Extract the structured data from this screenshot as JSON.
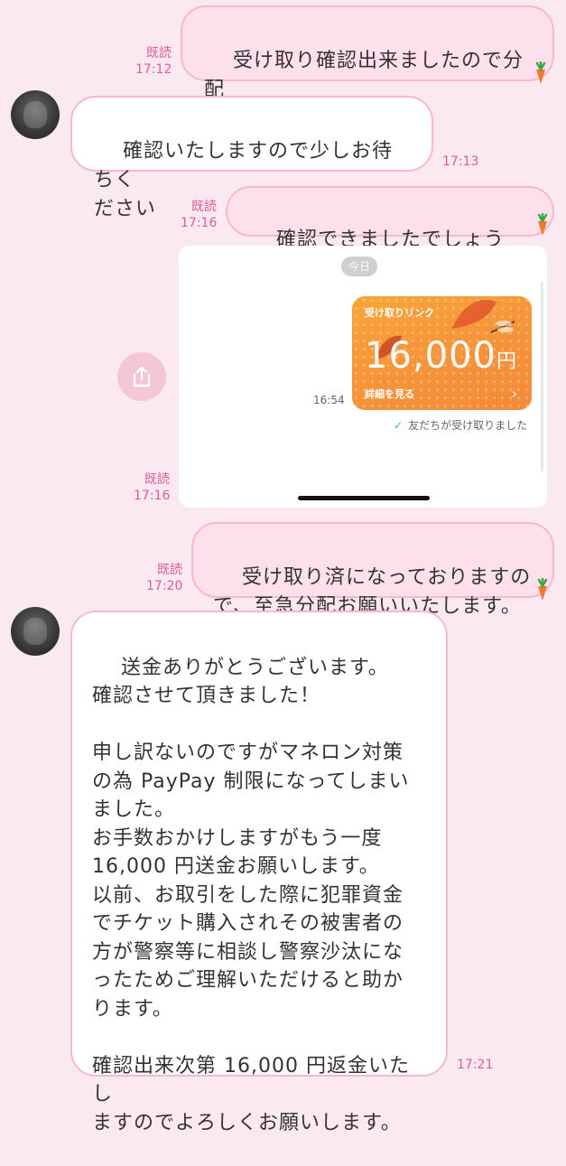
{
  "messages": [
    {
      "sender": "me",
      "text": "受け取り確認出来ましたので分配\nの方お願いいたします",
      "read": "既読",
      "time": "17:12"
    },
    {
      "sender": "other",
      "text": "確認いたしますので少しお待ちく\nださい",
      "time": "17:13"
    },
    {
      "sender": "me",
      "text": "確認できましたでしょうか？",
      "read": "既読",
      "time": "17:16"
    },
    {
      "sender": "me",
      "type": "image",
      "read": "既読",
      "time": "17:16"
    },
    {
      "sender": "me",
      "text": "受け取り済になっておりますの\nで、至急分配お願いいたします。",
      "read": "既読",
      "time": "17:20"
    },
    {
      "sender": "other",
      "text": "送金ありがとうございます。\n確認させて頂きました！\n\n申し訳ないのですがマネロン対策\nの為 PayPay 制限になってしまい\nました。\nお手数おかけしますがもう一度\n16,000 円送金お願いします。\n以前、お取引をした際に犯罪資金\nでチケット購入されその被害者の\n方が警察等に相談し警察沙汰にな\nったためご理解いただけると助か\nります。\n\n確認出来次第 16,000 円返金いたし\nますのでよろしくお願いします。",
      "time": "17:21"
    }
  ],
  "shared_image": {
    "date_label": "今日",
    "gift_label": "受け取りリンク",
    "amount": "16,000",
    "currency": "円",
    "detail_label": "詳細を見る",
    "time": "16:54",
    "status": "友だちが受け取りました"
  },
  "icons": {
    "share": "share-icon",
    "carrot": "carrot-icon",
    "check": "check-icon",
    "chevron": "chevron-right-icon"
  },
  "colors": {
    "background": "#fbe9f1",
    "outgoing_bubble": "#fde0ec",
    "bubble_border": "#f7b7cf",
    "read_time": "#e25c8d",
    "gift_card": "#f6933a"
  }
}
